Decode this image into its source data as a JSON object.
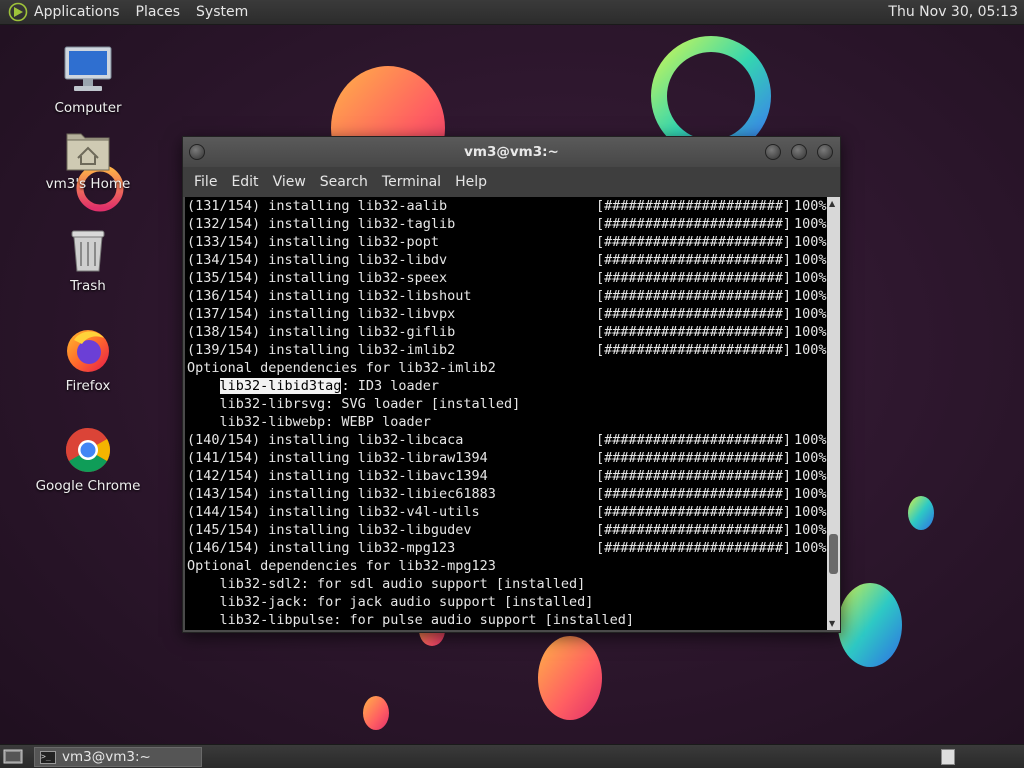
{
  "top_panel": {
    "menus": [
      "Applications",
      "Places",
      "System"
    ],
    "clock": "Thu Nov 30, 05:13"
  },
  "desktop_icons": [
    {
      "label": "Computer",
      "icon": "computer-icon"
    },
    {
      "label": "vm3's Home",
      "icon": "home-folder-icon"
    },
    {
      "label": "Trash",
      "icon": "trash-icon"
    },
    {
      "label": "Firefox",
      "icon": "firefox-icon"
    },
    {
      "label": "Google Chrome",
      "icon": "chrome-icon"
    }
  ],
  "terminal": {
    "title": "vm3@vm3:~",
    "menu": [
      "File",
      "Edit",
      "View",
      "Search",
      "Terminal",
      "Help"
    ],
    "lines": [
      {
        "kind": "progress",
        "text": "(131/154) installing lib32-aalib",
        "bar": "[######################]",
        "pct": "100%"
      },
      {
        "kind": "progress",
        "text": "(132/154) installing lib32-taglib",
        "bar": "[######################]",
        "pct": "100%"
      },
      {
        "kind": "progress",
        "text": "(133/154) installing lib32-popt",
        "bar": "[######################]",
        "pct": "100%"
      },
      {
        "kind": "progress",
        "text": "(134/154) installing lib32-libdv",
        "bar": "[######################]",
        "pct": "100%"
      },
      {
        "kind": "progress",
        "text": "(135/154) installing lib32-speex",
        "bar": "[######################]",
        "pct": "100%"
      },
      {
        "kind": "progress",
        "text": "(136/154) installing lib32-libshout",
        "bar": "[######################]",
        "pct": "100%"
      },
      {
        "kind": "progress",
        "text": "(137/154) installing lib32-libvpx",
        "bar": "[######################]",
        "pct": "100%"
      },
      {
        "kind": "progress",
        "text": "(138/154) installing lib32-giflib",
        "bar": "[######################]",
        "pct": "100%"
      },
      {
        "kind": "progress",
        "text": "(139/154) installing lib32-imlib2",
        "bar": "[######################]",
        "pct": "100%"
      },
      {
        "kind": "text",
        "text": "Optional dependencies for lib32-imlib2"
      },
      {
        "kind": "dep",
        "highlight": "lib32-libid3tag",
        "text": ": ID3 loader"
      },
      {
        "kind": "text",
        "text": "    lib32-librsvg: SVG loader [installed]"
      },
      {
        "kind": "text",
        "text": "    lib32-libwebp: WEBP loader"
      },
      {
        "kind": "progress",
        "text": "(140/154) installing lib32-libcaca",
        "bar": "[######################]",
        "pct": "100%"
      },
      {
        "kind": "progress",
        "text": "(141/154) installing lib32-libraw1394",
        "bar": "[######################]",
        "pct": "100%"
      },
      {
        "kind": "progress",
        "text": "(142/154) installing lib32-libavc1394",
        "bar": "[######################]",
        "pct": "100%"
      },
      {
        "kind": "progress",
        "text": "(143/154) installing lib32-libiec61883",
        "bar": "[######################]",
        "pct": "100%"
      },
      {
        "kind": "progress",
        "text": "(144/154) installing lib32-v4l-utils",
        "bar": "[######################]",
        "pct": "100%"
      },
      {
        "kind": "progress",
        "text": "(145/154) installing lib32-libgudev",
        "bar": "[######################]",
        "pct": "100%"
      },
      {
        "kind": "progress",
        "text": "(146/154) installing lib32-mpg123",
        "bar": "[######################]",
        "pct": "100%"
      },
      {
        "kind": "text",
        "text": "Optional dependencies for lib32-mpg123"
      },
      {
        "kind": "text",
        "text": "    lib32-sdl2: for sdl audio support [installed]"
      },
      {
        "kind": "text",
        "text": "    lib32-jack: for jack audio support [installed]"
      },
      {
        "kind": "text",
        "text": "    lib32-libpulse: for pulse audio support [installed]"
      }
    ],
    "scroll_position": 0.88
  },
  "taskbar": {
    "task_label": "vm3@vm3:~"
  },
  "colors": {
    "wallpaper_bg": "#2a1428",
    "panel": "#333333",
    "terminal_bg": "#000000",
    "terminal_fg": "#e6e6e6"
  }
}
